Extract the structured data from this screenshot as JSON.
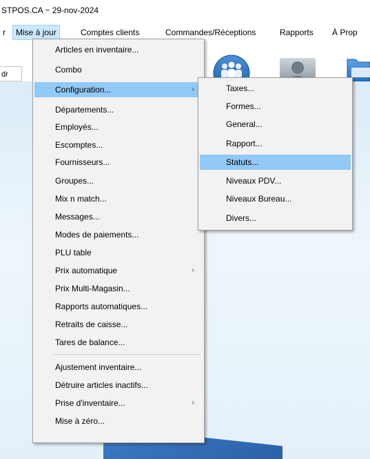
{
  "window": {
    "title": "STPOS.CA ~ 29-nov-2024"
  },
  "menubar": {
    "items": [
      {
        "label": "r"
      },
      {
        "label": "Mise à jour"
      },
      {
        "label": "Comptes clients"
      },
      {
        "label": "Commandes/Réceptions"
      },
      {
        "label": "Rapports"
      },
      {
        "label": "À Prop"
      }
    ]
  },
  "toolbar": {
    "address_value": "dr",
    "icons": [
      "team-icon",
      "user-silhouette-icon",
      "folder-icon"
    ]
  },
  "main_menu": {
    "items": [
      {
        "label": "Articles en inventaire..."
      },
      {
        "label": "Combo"
      },
      {
        "label": "Configuration...",
        "has_submenu": true,
        "highlighted": true
      },
      {
        "label": "Départements..."
      },
      {
        "label": "Employés..."
      },
      {
        "label": "Escomptes..."
      },
      {
        "label": "Fournisseurs..."
      },
      {
        "label": "Groupes..."
      },
      {
        "label": "Mix n match..."
      },
      {
        "label": "Messages..."
      },
      {
        "label": "Modes de paiements..."
      },
      {
        "label": "PLU table"
      },
      {
        "label": "Prix automatique",
        "has_submenu": true
      },
      {
        "label": "Prix Multi-Magasin..."
      },
      {
        "label": "Rapports automatiques..."
      },
      {
        "label": "Retraits de caisse..."
      },
      {
        "label": "Tares de balance..."
      },
      {
        "label": "Ajustement inventaire..."
      },
      {
        "label": "Détruire articles inactifs..."
      },
      {
        "label": "Prise d'inventaire...",
        "has_submenu": true
      },
      {
        "label": "Mise à zéro..."
      }
    ]
  },
  "config_submenu": {
    "items": [
      {
        "label": "Taxes..."
      },
      {
        "label": "Formes..."
      },
      {
        "label": "General..."
      },
      {
        "label": "Rapport..."
      },
      {
        "label": "Statuts...",
        "highlighted": true
      },
      {
        "label": "Niveaux PDV..."
      },
      {
        "label": "Niveaux Bureau..."
      },
      {
        "label": "Divers..."
      }
    ]
  },
  "glyphs": {
    "submenu_arrow": "›"
  },
  "colors": {
    "menu_highlight": "#91c9f7",
    "menubar_open": "#cce8ff",
    "menu_bg": "#f2f2f2",
    "content_bg": "#dcecf8"
  }
}
